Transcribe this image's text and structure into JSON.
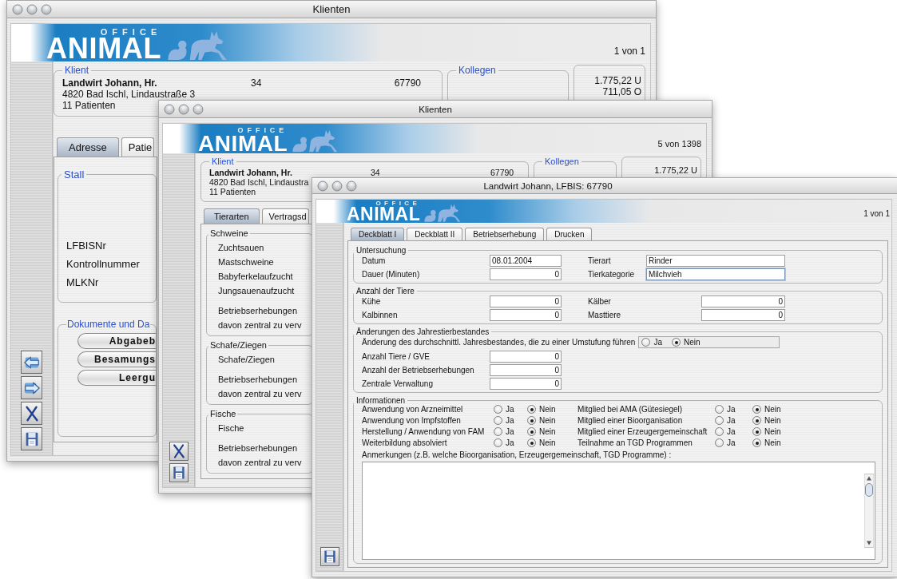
{
  "client_window": {
    "title": "Klienten",
    "logo": {
      "subtitle": "OFFICE",
      "title": "ANIMAL"
    },
    "record": "1 von 1",
    "client": {
      "heading": "Klient",
      "name": "Landwirt Johann, Hr.",
      "number": "34",
      "lfbis": "67790",
      "address": "4820 Bad Ischl, Lindaustraße 3",
      "patients": "11 Patienten"
    },
    "colleagues": {
      "heading": "Kollegen"
    },
    "balances": [
      "1.775,22 U",
      "711,05 O"
    ],
    "tabs": [
      {
        "label": "Adresse",
        "selected": true
      },
      {
        "label": "Patie",
        "selected": false
      }
    ],
    "stall": {
      "heading": "Stall",
      "fields": [
        "LFBISNr",
        "Kontrollnummer",
        "MLKNr"
      ]
    },
    "documents": {
      "heading": "Dokumente und Da",
      "buttons": [
        "Abgabeb",
        "Besamungs",
        "Leergu"
      ]
    },
    "toolbar": [
      {
        "kind": "back"
      },
      {
        "kind": "forward"
      },
      {
        "kind": "delete"
      },
      {
        "kind": "save"
      }
    ]
  },
  "animals_window": {
    "title": "Klienten",
    "logo": {
      "subtitle": "OFFICE",
      "title": "ANIMAL"
    },
    "record": "5 von 1398",
    "client": {
      "heading": "Klient",
      "name": "Landwirt Johann, Hr.",
      "number": "34",
      "lfbis": "67790",
      "address": "4820 Bad Ischl, Lindaustra",
      "patients": "11 Patienten"
    },
    "colleagues": {
      "heading": "Kollegen"
    },
    "balances": [
      "1.775,22 U"
    ],
    "tabs": [
      {
        "label": "Tierarten",
        "selected": true
      },
      {
        "label": "Vertragsd",
        "selected": false
      }
    ],
    "groups": [
      {
        "heading": "Schweine",
        "items": [
          "Zuchtsauen",
          "Mastschweine",
          "Babyferkelaufzucht",
          "Jungsauenaufzucht"
        ],
        "survey": [
          "Betriebserhebungen",
          "davon zentral zu verv"
        ]
      },
      {
        "heading": "Schafe/Ziegen",
        "items": [
          "Schafe/Ziegen"
        ],
        "survey": [
          "Betriebserhebungen",
          "davon zentral zu verv"
        ]
      },
      {
        "heading": "Fische",
        "items": [
          "Fische"
        ],
        "survey": [
          "Betriebserhebungen",
          "davon zentral zu verv"
        ]
      }
    ],
    "toolbar": [
      {
        "kind": "delete"
      },
      {
        "kind": "save"
      }
    ]
  },
  "form_window": {
    "title": "Landwirt Johann, LFBIS: 67790",
    "logo": {
      "subtitle": "OFFICE",
      "title": "ANIMAL"
    },
    "record": "1 von 1",
    "tabs": [
      {
        "label": "Deckblatt I",
        "selected": true
      },
      {
        "label": "Deckblatt II",
        "selected": false
      },
      {
        "label": "Betriebserhebung",
        "selected": false
      },
      {
        "label": "Drucken",
        "selected": false
      }
    ],
    "examination": {
      "heading": "Untersuchung",
      "fields": [
        {
          "label": "Datum",
          "value": "08.01.2004",
          "kind": "text",
          "focused": false
        },
        {
          "label": "Tierart",
          "value": "Rinder",
          "kind": "wide",
          "focused": false
        },
        {
          "label": "Dauer (Minuten)",
          "value": "0",
          "kind": "number",
          "focused": false
        },
        {
          "label": "Tierkategorie",
          "value": "Milchvieh",
          "kind": "wide",
          "focused": true
        }
      ]
    },
    "animal_counts": {
      "heading": "Anzahl der Tiere",
      "fields": [
        {
          "label": "Kühe",
          "value": "0"
        },
        {
          "label": "Kälber",
          "value": "0"
        },
        {
          "label": "Kalbinnen",
          "value": "0"
        },
        {
          "label": "Masttiere",
          "value": "0"
        }
      ]
    },
    "changes": {
      "heading": "Änderungen des Jahrestierbestandes",
      "question": "Änderung des durchschnittl. Jahresbestandes, die zu einer Umstufung führen",
      "options": [
        {
          "label": "Ja",
          "selected": false
        },
        {
          "label": "Nein",
          "selected": true
        }
      ],
      "fields": [
        {
          "label": "Anzahl Tiere / GVE",
          "value": "0"
        },
        {
          "label": "Anzahl der Betriebserhebungen",
          "value": "0"
        },
        {
          "label": "Zentrale Verwaltung",
          "value": "0"
        }
      ]
    },
    "information": {
      "heading": "Informationen",
      "questions": [
        {
          "label": "Anwendung von Arzneimittel",
          "options": [
            {
              "label": "Ja",
              "selected": false
            },
            {
              "label": "Nein",
              "selected": true
            }
          ]
        },
        {
          "label": "Mitglied bei AMA (Gütesiegel)",
          "options": [
            {
              "label": "Ja",
              "selected": false
            },
            {
              "label": "Nein",
              "selected": true
            }
          ]
        },
        {
          "label": "Anwendung von Impfstoffen",
          "options": [
            {
              "label": "Ja",
              "selected": false
            },
            {
              "label": "Nein",
              "selected": true
            }
          ]
        },
        {
          "label": "Mitglied einer Bioorganisation",
          "options": [
            {
              "label": "Ja",
              "selected": false
            },
            {
              "label": "Nein",
              "selected": true
            }
          ]
        },
        {
          "label": "Herstellung / Anwendung von FAM",
          "options": [
            {
              "label": "Ja",
              "selected": false
            },
            {
              "label": "Nein",
              "selected": true
            }
          ]
        },
        {
          "label": "Mitglied einer Erzeugergemeinschaft",
          "options": [
            {
              "label": "Ja",
              "selected": false
            },
            {
              "label": "Nein",
              "selected": true
            }
          ]
        },
        {
          "label": "Weiterbildung absolviert",
          "options": [
            {
              "label": "Ja",
              "selected": false
            },
            {
              "label": "Nein",
              "selected": true
            }
          ]
        },
        {
          "label": "Teilnahme an TGD Programmen",
          "options": [
            {
              "label": "Ja",
              "selected": false
            },
            {
              "label": "Nein",
              "selected": true
            }
          ]
        }
      ],
      "notes_label": "Anmerkungen (z.B. welche Bioorganisation, Erzeugergemeinschaft, TGD Programme) :"
    },
    "toolbar": [
      {
        "kind": "save"
      }
    ]
  }
}
